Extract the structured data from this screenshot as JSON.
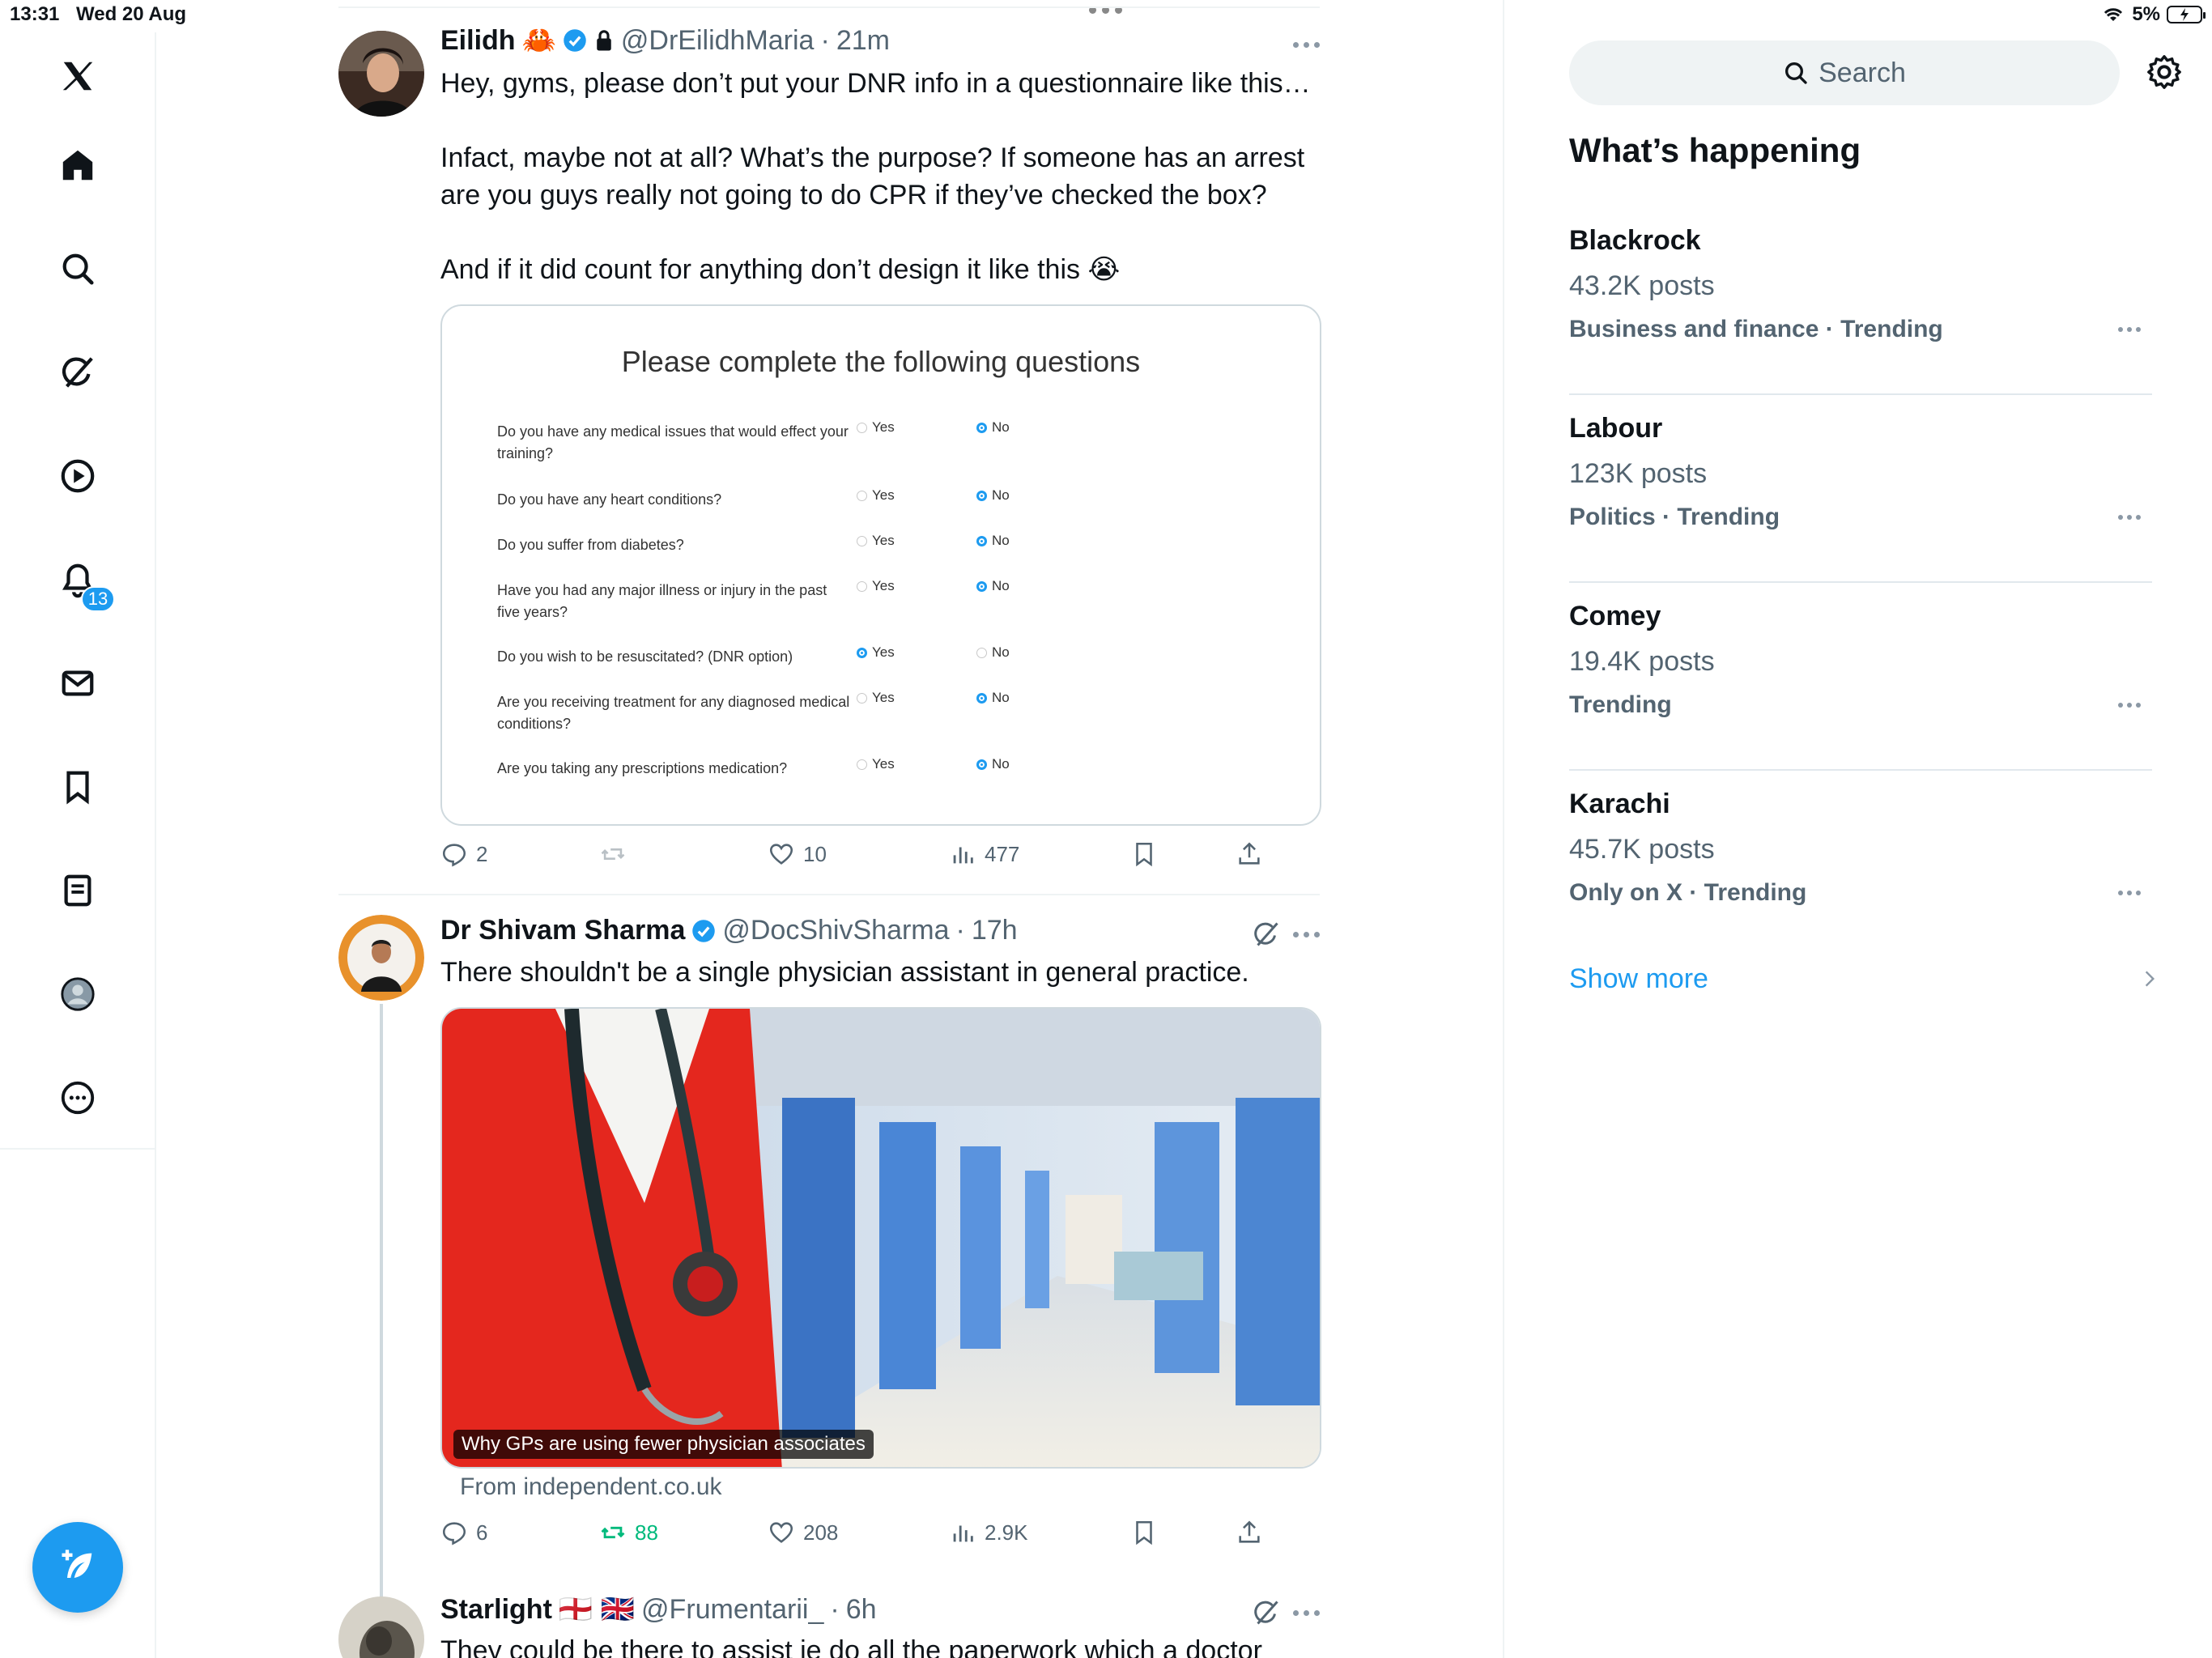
{
  "status_bar": {
    "time": "13:31",
    "date": "Wed 20 Aug",
    "battery": "5%"
  },
  "nav": {
    "notifications_count": "13",
    "items": [
      "x-logo-icon",
      "home-icon",
      "search-icon",
      "grok-icon",
      "video-icon",
      "notifications-icon",
      "messages-icon",
      "bookmarks-icon",
      "lists-icon",
      "profile-icon",
      "more-icon"
    ]
  },
  "posts": [
    {
      "name": "Eilidh",
      "emoji": "🦀",
      "handle": "@DrEilidhMaria",
      "sep": "·",
      "time": "21m",
      "text": "Hey, gyms, please don’t put your DNR info in a questionnaire like this…\n\nInfact, maybe not at all? What’s the purpose? If someone has an arrest are you guys really not going to do CPR if they’ve checked the box?\n\nAnd if it did count for anything don’t design it like this 😭",
      "form": {
        "title": "Please complete the following questions",
        "yes_label": "Yes",
        "no_label": "No",
        "questions": [
          {
            "q": "Do you have any medical issues that would effect your training?",
            "answer": "No"
          },
          {
            "q": "Do you have any heart conditions?",
            "answer": "No"
          },
          {
            "q": "Do you suffer from diabetes?",
            "answer": "No"
          },
          {
            "q": "Have you had any major illness or injury in the past five years?",
            "answer": "No"
          },
          {
            "q": "Do you wish to be resuscitated? (DNR option)",
            "answer": "Yes"
          },
          {
            "q": "Are you receiving treatment for any diagnosed medical conditions?",
            "answer": "No"
          },
          {
            "q": "Are you taking any prescriptions medication?",
            "answer": "No"
          }
        ]
      },
      "replies": "2",
      "reposts": "",
      "likes": "10",
      "views": "477"
    },
    {
      "name": "Dr Shivam Sharma",
      "handle": "@DocShivSharma",
      "sep": "·",
      "time": "17h",
      "text": "There shouldn't be a single physician assistant in general practice.",
      "media_caption": "Why GPs are using fewer physician associates",
      "source": "From independent.co.uk",
      "replies": "6",
      "reposts": "88",
      "likes": "208",
      "views": "2.9K"
    },
    {
      "name": "Starlight",
      "flags": "🏴󠁧󠁢󠁥󠁮󠁧󠁿 🇬🇧",
      "handle": "@Frumentarii_",
      "sep": "·",
      "time": "6h",
      "text": "They could be there to assist ie do all the paperwork which a doctor"
    }
  ],
  "sidebar": {
    "search_placeholder": "Search",
    "title": "What’s happening",
    "trends": [
      {
        "name": "Blackrock",
        "posts": "43.2K posts",
        "category": "Business and finance · Trending"
      },
      {
        "name": "Labour",
        "posts": "123K posts",
        "category": "Politics · Trending"
      },
      {
        "name": "Comey",
        "posts": "19.4K posts",
        "category": "Trending"
      },
      {
        "name": "Karachi",
        "posts": "45.7K posts",
        "category": "Only on X · Trending"
      }
    ],
    "show_more": "Show more"
  },
  "colors": {
    "accent": "#1d9bf0",
    "repost_active": "#00ba7c",
    "text": "#0f1419",
    "muted": "#536471"
  }
}
